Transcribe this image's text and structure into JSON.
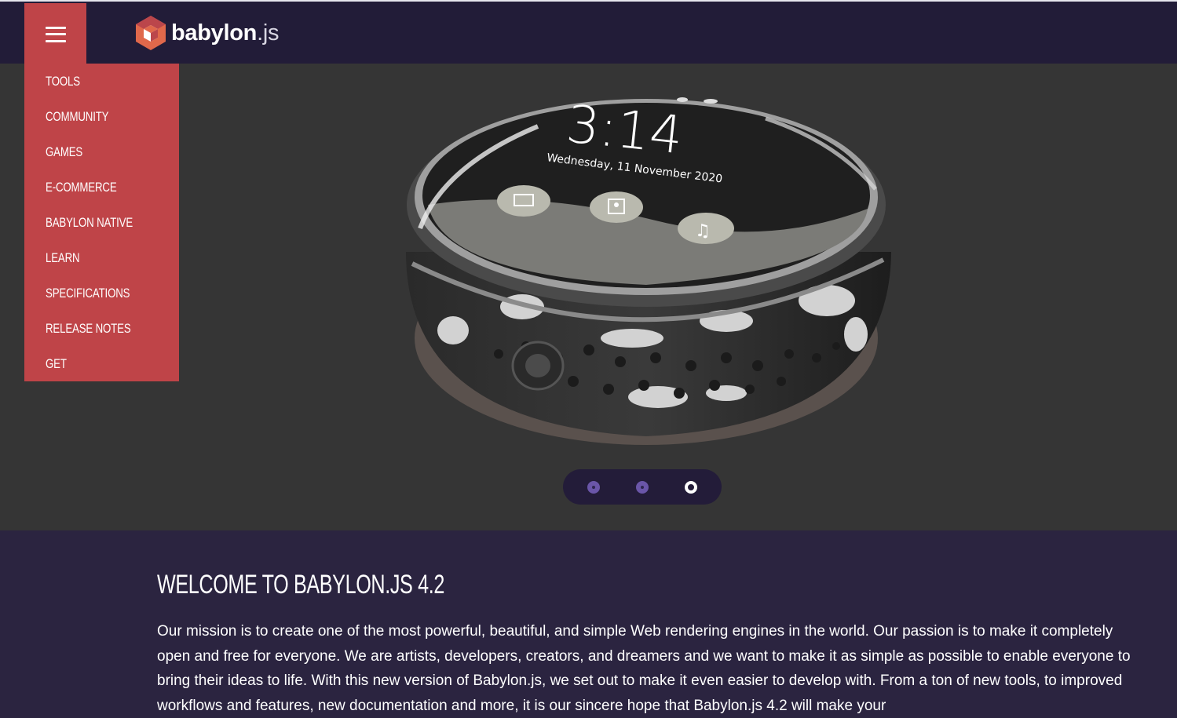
{
  "header": {
    "menu_icon": "hamburger-menu-icon",
    "logo_icon": "babylon-hex-logo",
    "logo_main": "babylon",
    "logo_ext": ".js"
  },
  "nav": {
    "items": [
      {
        "label": "TOOLS"
      },
      {
        "label": "COMMUNITY"
      },
      {
        "label": "GAMES"
      },
      {
        "label": "E-COMMERCE"
      },
      {
        "label": "BABYLON NATIVE"
      },
      {
        "label": "LEARN"
      },
      {
        "label": "SPECIFICATIONS"
      },
      {
        "label": "RELEASE NOTES"
      },
      {
        "label": "GET"
      }
    ]
  },
  "hero": {
    "time": "3:14",
    "date": "Wednesday, 11 November 2020",
    "carousel": {
      "count": 3,
      "active_index": 3
    }
  },
  "welcome": {
    "title": "WELCOME TO BABYLON.JS 4.2",
    "body": "Our mission is to create one of the most powerful, beautiful, and simple Web rendering engines in the world. Our passion is to make it completely open and free for everyone. We are artists, developers, creators, and dreamers and we want to make it as simple as possible to enable everyone to bring their ideas to life. With this new version of Babylon.js, we set out to make it even easier to develop with. From a ton of new tools, to improved workflows and features, new documentation and more, it is our sincere hope that Babylon.js 4.2 will make your"
  },
  "colors": {
    "header_bg": "#221c38",
    "accent_red": "#bf4448",
    "hero_bg": "#353535",
    "section_bg": "#2b2440",
    "carousel_dot": "#6a56a8"
  }
}
